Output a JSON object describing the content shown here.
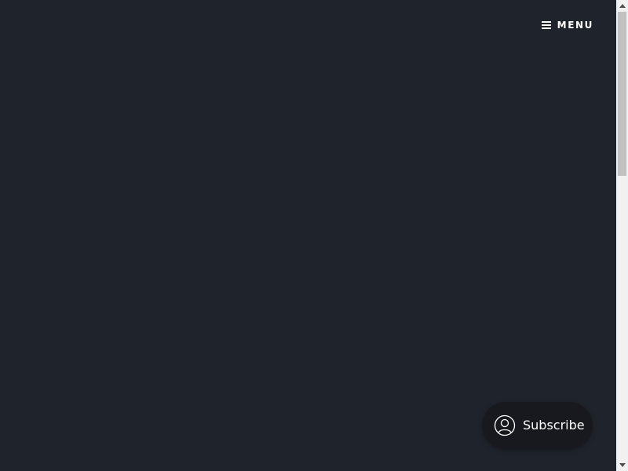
{
  "header": {
    "menu_label": "MENU",
    "menu_icon": "hamburger-icon"
  },
  "subscribe_widget": {
    "label": "Subscribe",
    "icon": "user-icon"
  },
  "colors": {
    "background": "#1f232b",
    "subscribe_background": "#17191e",
    "text": "#ffffff",
    "scrollbar_track": "#f1f1f1",
    "scrollbar_thumb": "#c1c1c1"
  }
}
